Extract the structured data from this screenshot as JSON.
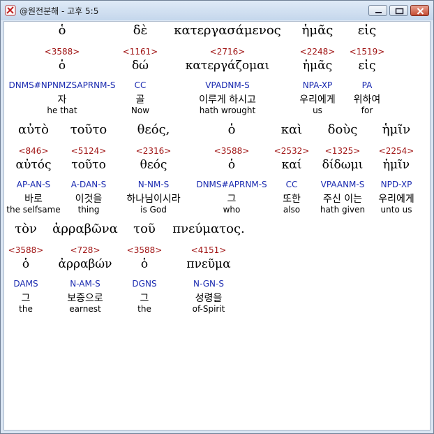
{
  "window": {
    "title": "@원전분해 - 고후 5:5",
    "colors": {
      "strong": "#a01414",
      "morph": "#1a2ab0",
      "text": "#000000"
    }
  },
  "rows": [
    [
      {
        "greek": "ὁ",
        "strong": "<3588>",
        "lemma": "ὁ",
        "morph": "DNMS#NPNMZSAPRNM-S",
        "korean": "자",
        "english": "he that"
      },
      {
        "greek": "δὲ",
        "strong": "<1161>",
        "lemma": "δώ",
        "morph": "CC",
        "korean": "골",
        "english": "Now"
      },
      {
        "greek": "κατεργασάμενος",
        "strong": "<2716>",
        "lemma": "κατεργάζομαι",
        "morph": "VPADNM-S",
        "korean": "이루게 하시고",
        "english": "hath wrought"
      },
      {
        "greek": "ἡμᾶς",
        "strong": "<2248>",
        "lemma": "ἡμᾶς",
        "morph": "NPA-XP",
        "korean": "우리에게",
        "english": "us"
      },
      {
        "greek": "εἰς",
        "strong": "<1519>",
        "lemma": "εἰς",
        "morph": "PA",
        "korean": "위하여",
        "english": "for"
      }
    ],
    [
      {
        "greek": "αὐτὸ",
        "strong": "<846>",
        "lemma": "αὐτός",
        "morph": "AP-AN-S",
        "korean": "바로",
        "english": "the selfsame"
      },
      {
        "greek": "τοῦτο",
        "strong": "<5124>",
        "lemma": "τοῦτο",
        "morph": "A-DAN-S",
        "korean": "이것을",
        "english": "thing"
      },
      {
        "greek": "θεός,",
        "strong": "<2316>",
        "lemma": "θεός",
        "morph": "N-NM-S",
        "korean": "하나님이시라",
        "english": "is God"
      },
      {
        "greek": "ὁ",
        "strong": "<3588>",
        "lemma": "ὁ",
        "morph": "DNMS#APRNM-S",
        "korean": "그",
        "english": "who"
      },
      {
        "greek": "καὶ",
        "strong": "<2532>",
        "lemma": "καί",
        "morph": "CC",
        "korean": "또한",
        "english": "also"
      },
      {
        "greek": "δοὺς",
        "strong": "<1325>",
        "lemma": "δίδωμι",
        "morph": "VPAANM-S",
        "korean": "주신 이는",
        "english": "hath given"
      },
      {
        "greek": "ἡμῖν",
        "strong": "<2254>",
        "lemma": "ἡμῖν",
        "morph": "NPD-XP",
        "korean": "우리에게",
        "english": "unto us"
      }
    ],
    [
      {
        "greek": "τὸν",
        "strong": "<3588>",
        "lemma": "ὁ",
        "morph": "DAMS",
        "korean": "그",
        "english": "the"
      },
      {
        "greek": "ἀρραβῶνα",
        "strong": "<728>",
        "lemma": "ἀρραβών",
        "morph": "N-AM-S",
        "korean": "보증으로",
        "english": "earnest"
      },
      {
        "greek": "τοῦ",
        "strong": "<3588>",
        "lemma": "ὁ",
        "morph": "DGNS",
        "korean": "그",
        "english": "the"
      },
      {
        "greek": "πνεύματος.",
        "strong": "<4151>",
        "lemma": "πνεῦμα",
        "morph": "N-GN-S",
        "korean": "성령을",
        "english": "of-Spirit"
      }
    ]
  ]
}
